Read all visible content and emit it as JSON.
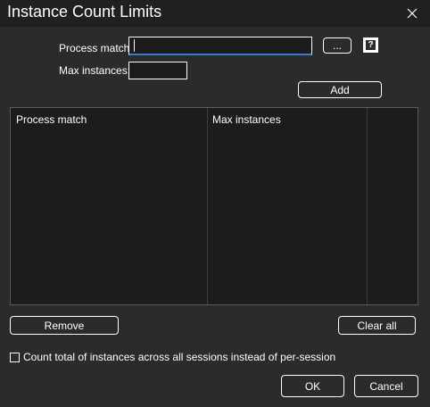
{
  "window": {
    "title": "Instance Count Limits"
  },
  "form": {
    "process_match_label": "Process match:",
    "process_match_value": "",
    "max_instances_label": "Max instances:",
    "max_instances_value": "",
    "browse_label": "...",
    "help_label": "?",
    "add_label": "Add"
  },
  "list": {
    "columns": [
      "Process match",
      "Max instances"
    ],
    "rows": []
  },
  "actions": {
    "remove_label": "Remove",
    "clear_all_label": "Clear all",
    "checkbox_label": "Count total of instances across all sessions instead of per-session",
    "checkbox_checked": false,
    "ok_label": "OK",
    "cancel_label": "Cancel"
  }
}
